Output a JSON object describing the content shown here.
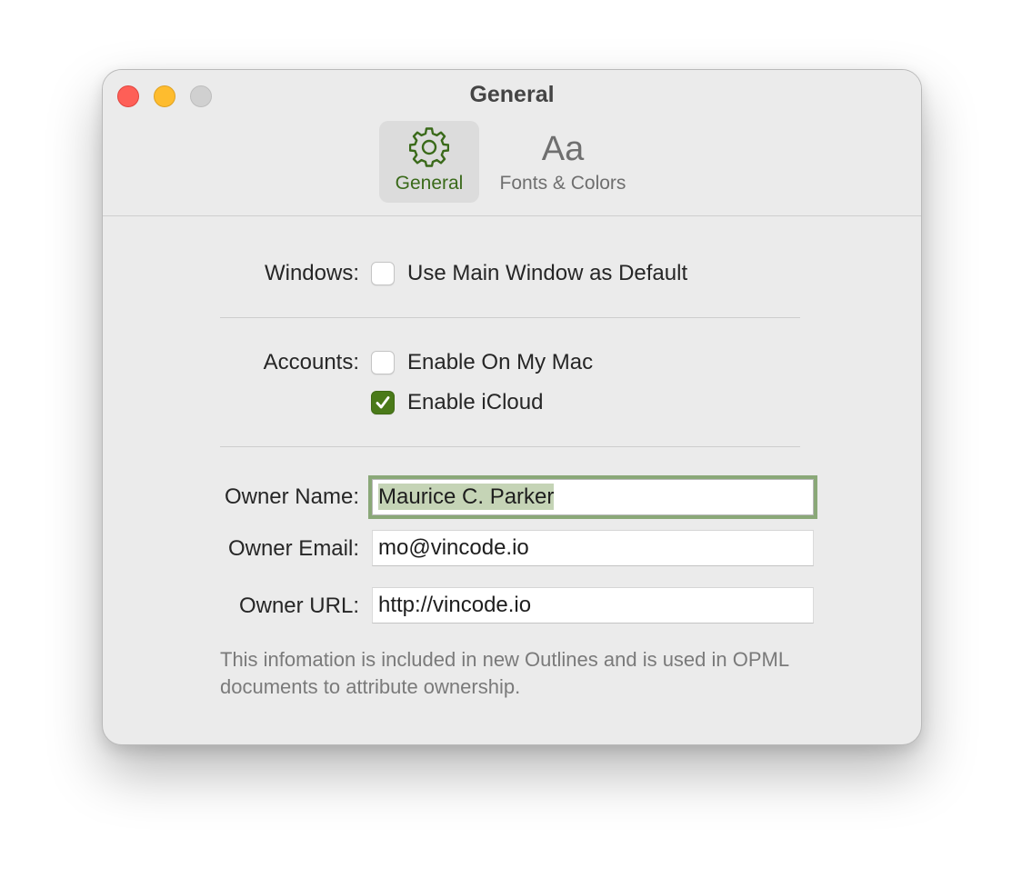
{
  "window": {
    "title": "General"
  },
  "toolbar": {
    "tabs": [
      {
        "label": "General",
        "icon": "gear-icon",
        "selected": true
      },
      {
        "label": "Fonts & Colors",
        "icon_text": "Aa",
        "selected": false
      }
    ]
  },
  "windows_section": {
    "label": "Windows:",
    "options": [
      {
        "label": "Use Main Window as Default",
        "checked": false
      }
    ]
  },
  "accounts_section": {
    "label": "Accounts:",
    "options": [
      {
        "label": "Enable On My Mac",
        "checked": false
      },
      {
        "label": "Enable iCloud",
        "checked": true
      }
    ]
  },
  "owner": {
    "name_label": "Owner Name:",
    "name_value": "Maurice C. Parker",
    "email_label": "Owner Email:",
    "email_value": "mo@vincode.io",
    "url_label": "Owner URL:",
    "url_value": "http://vincode.io"
  },
  "help_text": "This infomation is included in new Outlines and is used in OPML documents to attribute ownership.",
  "colors": {
    "accent": "#4a7a19",
    "close": "#fe5f57",
    "minimize": "#febc2e",
    "zoom": "#d0d0d0",
    "focus_ring": "#8aa878"
  }
}
